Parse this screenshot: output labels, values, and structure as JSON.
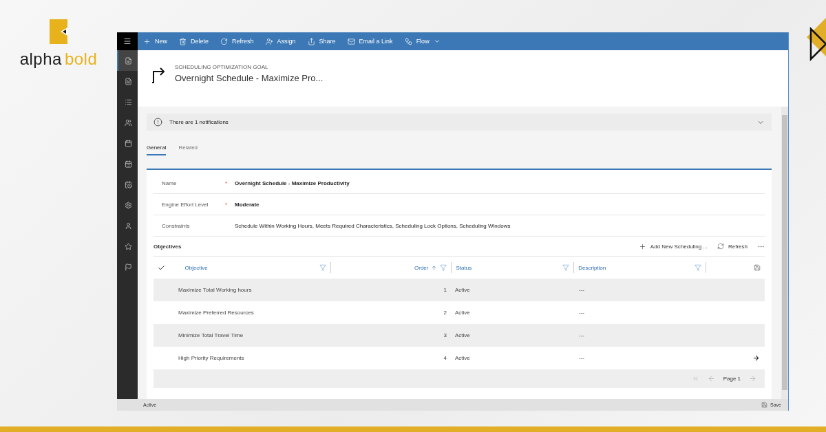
{
  "logo": {
    "text_1": "alpha",
    "text_2": "bold"
  },
  "nav": [
    {
      "selected": true
    },
    {
      "selected": false
    },
    {
      "selected": false
    },
    {
      "selected": false
    },
    {
      "selected": false
    },
    {
      "selected": false
    },
    {
      "selected": false
    },
    {
      "selected": false
    },
    {
      "selected": false
    },
    {
      "selected": false
    },
    {
      "selected": false
    }
  ],
  "commands": [
    {
      "label": "New"
    },
    {
      "label": "Delete"
    },
    {
      "label": "Refresh"
    },
    {
      "label": "Assign"
    },
    {
      "label": "Share"
    },
    {
      "label": "Email a Link"
    },
    {
      "label": "Flow",
      "dropdown": true
    }
  ],
  "header": {
    "entity": "SCHEDULING OPTIMIZATION GOAL",
    "title": "Overnight Schedule - Maximize Pro..."
  },
  "notification": {
    "text": "There are 1 notifications",
    "expanded": false
  },
  "tabs": [
    {
      "label": "General",
      "selected": true
    },
    {
      "label": "Related",
      "selected": false
    }
  ],
  "fields": [
    {
      "label": "Name",
      "required_mark": "*",
      "value": "Overnight Schedule - Maximize Productivity",
      "bold": true
    },
    {
      "label": "Engine Effort Level",
      "required_mark": "*",
      "value": "Moderate",
      "bold": true
    },
    {
      "label": "Constraints",
      "value": "Schedule Within Working Hours, Meets Required Characteristics, Scheduling Lock Options, Scheduling Windows",
      "bold": false
    }
  ],
  "objectives": {
    "title": "Objectives",
    "actions": [
      {
        "label": "Add New Scheduling ..."
      },
      {
        "label": "Refresh"
      }
    ],
    "columns": [
      "Objective",
      "Order",
      "Status",
      "Description"
    ],
    "rows": [
      {
        "objective": "Maximize Total Working hours",
        "order": "1",
        "status": "Active",
        "description": "---"
      },
      {
        "objective": "Maximize Preferred Resources",
        "order": "2",
        "status": "Active",
        "description": "---"
      },
      {
        "objective": "Minimize Total Travel Time",
        "order": "3",
        "status": "Active",
        "description": "---"
      },
      {
        "objective": "High Priority Requirements",
        "order": "4",
        "status": "Active",
        "description": "---"
      }
    ],
    "page": "Page 1"
  },
  "status_bar": {
    "status": "Active",
    "save": "Save"
  }
}
